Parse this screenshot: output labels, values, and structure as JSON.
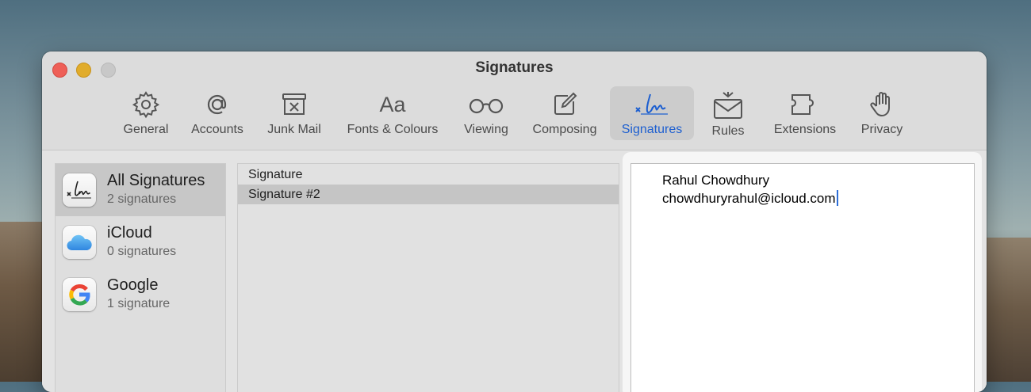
{
  "window": {
    "title": "Signatures"
  },
  "toolbar": [
    {
      "label": "General",
      "icon": "gear-icon"
    },
    {
      "label": "Accounts",
      "icon": "at-sign-icon"
    },
    {
      "label": "Junk Mail",
      "icon": "junk-mail-icon"
    },
    {
      "label": "Fonts & Colours",
      "icon": "fonts-icon"
    },
    {
      "label": "Viewing",
      "icon": "glasses-icon"
    },
    {
      "label": "Composing",
      "icon": "compose-icon"
    },
    {
      "label": "Signatures",
      "icon": "signature-icon"
    },
    {
      "label": "Rules",
      "icon": "rules-envelope-icon"
    },
    {
      "label": "Extensions",
      "icon": "puzzle-icon"
    },
    {
      "label": "Privacy",
      "icon": "hand-icon"
    }
  ],
  "toolbar_selected": "Signatures",
  "accounts": [
    {
      "name": "All Signatures",
      "count": "2 signatures",
      "icon": "signature-icon"
    },
    {
      "name": "iCloud",
      "count": "0 signatures",
      "icon": "icloud-icon"
    },
    {
      "name": "Google",
      "count": "1 signature",
      "icon": "google-icon"
    }
  ],
  "signatures": [
    "Signature",
    "Signature #2"
  ],
  "editor": {
    "lines": [
      "Rahul Chowdhury",
      "chowdhuryrahul@icloud.com"
    ]
  },
  "colors": {
    "accent": "#1d5fd0",
    "selection": "#c7c7c7"
  }
}
